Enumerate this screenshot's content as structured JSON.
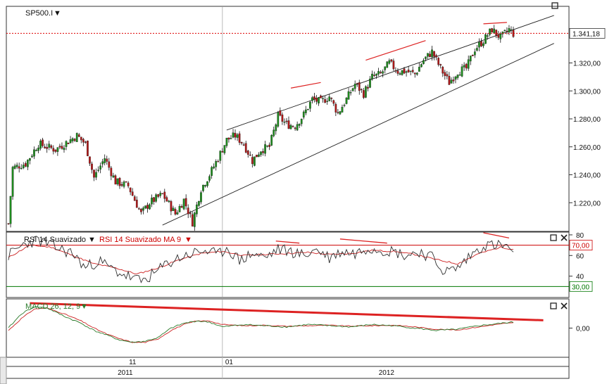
{
  "chart_data": [
    {
      "type": "candlestick",
      "panel": "price",
      "symbol": "SP500.I",
      "ylim": [
        1200,
        1360
      ],
      "y_ticks": [
        1220,
        1240,
        1260,
        1280,
        1300,
        1320
      ],
      "y_tick_labels": [
        "1.220,00",
        "1.240,00",
        "1.260,00",
        "1.280,00",
        "1.300,00",
        "1.320,00"
      ],
      "last_price": 1341.18,
      "last_price_label": "1.341,18",
      "colors": {
        "up": "#1e8c1e",
        "down": "#b01818",
        "price_line": "#dd0000"
      },
      "close_path": [
        [
          0,
          1205
        ],
        [
          2,
          1245
        ],
        [
          8,
          1248
        ],
        [
          14,
          1262
        ],
        [
          22,
          1258
        ],
        [
          28,
          1264
        ],
        [
          32,
          1268
        ],
        [
          36,
          1262
        ],
        [
          40,
          1238
        ],
        [
          45,
          1252
        ],
        [
          50,
          1235
        ],
        [
          56,
          1232
        ],
        [
          62,
          1212
        ],
        [
          66,
          1220
        ],
        [
          72,
          1226
        ],
        [
          78,
          1212
        ],
        [
          82,
          1222
        ],
        [
          86,
          1206
        ],
        [
          90,
          1230
        ],
        [
          94,
          1240
        ],
        [
          98,
          1252
        ],
        [
          102,
          1265
        ],
        [
          106,
          1268
        ],
        [
          110,
          1262
        ],
        [
          114,
          1250
        ],
        [
          118,
          1258
        ],
        [
          122,
          1260
        ],
        [
          126,
          1282
        ],
        [
          130,
          1276
        ],
        [
          134,
          1275
        ],
        [
          138,
          1283
        ],
        [
          142,
          1294
        ],
        [
          146,
          1292
        ],
        [
          150,
          1296
        ],
        [
          154,
          1284
        ],
        [
          158,
          1294
        ],
        [
          162,
          1305
        ],
        [
          166,
          1298
        ],
        [
          170,
          1310
        ],
        [
          174,
          1312
        ],
        [
          178,
          1320
        ],
        [
          182,
          1314
        ],
        [
          186,
          1314
        ],
        [
          190,
          1312
        ],
        [
          194,
          1322
        ],
        [
          198,
          1328
        ],
        [
          202,
          1316
        ],
        [
          206,
          1306
        ],
        [
          210,
          1314
        ],
        [
          214,
          1316
        ],
        [
          218,
          1330
        ],
        [
          222,
          1336
        ],
        [
          226,
          1344
        ],
        [
          230,
          1338
        ],
        [
          234,
          1344
        ],
        [
          236,
          1341
        ]
      ],
      "trendlines": [
        {
          "kind": "upper-wedge",
          "x1": 102,
          "y1": 1272,
          "x2": 255,
          "y2": 1354,
          "color": "#222222"
        },
        {
          "kind": "lower-wedge",
          "x1": 72,
          "y1": 1204,
          "x2": 255,
          "y2": 1334,
          "color": "#222222"
        },
        {
          "kind": "divergence",
          "x1": 132,
          "y1": 1302,
          "x2": 146,
          "y2": 1306,
          "color": "#dd2222"
        },
        {
          "kind": "divergence",
          "x1": 167,
          "y1": 1322,
          "x2": 195,
          "y2": 1336,
          "color": "#dd2222"
        },
        {
          "kind": "divergence",
          "x1": 222,
          "y1": 1348,
          "x2": 233,
          "y2": 1349,
          "color": "#dd2222"
        }
      ]
    },
    {
      "type": "line",
      "panel": "rsi",
      "title": "RSI 14 Suavizado",
      "ma_title": "RSI 14 Suavizado MA 9",
      "ylim": [
        20,
        82
      ],
      "y_ticks": [
        40,
        60,
        80
      ],
      "y_tick_labels": [
        "40",
        "60",
        "80"
      ],
      "levels": [
        {
          "value": 70,
          "label": "70,00",
          "color": "#cc0000"
        },
        {
          "value": 30,
          "label": "30,00",
          "color": "#007700"
        }
      ],
      "series": [
        {
          "name": "RSI 14 Suavizado",
          "color": "#303030",
          "path": [
            [
              0,
              60
            ],
            [
              8,
              72
            ],
            [
              14,
              75
            ],
            [
              22,
              68
            ],
            [
              30,
              62
            ],
            [
              36,
              48
            ],
            [
              42,
              55
            ],
            [
              50,
              45
            ],
            [
              58,
              38
            ],
            [
              62,
              35
            ],
            [
              68,
              42
            ],
            [
              74,
              52
            ],
            [
              80,
              58
            ],
            [
              86,
              62
            ],
            [
              92,
              65
            ],
            [
              98,
              60
            ],
            [
              102,
              68
            ],
            [
              108,
              55
            ],
            [
              114,
              62
            ],
            [
              120,
              58
            ],
            [
              126,
              66
            ],
            [
              132,
              64
            ],
            [
              138,
              60
            ],
            [
              144,
              66
            ],
            [
              150,
              58
            ],
            [
              156,
              64
            ],
            [
              162,
              62
            ],
            [
              168,
              68
            ],
            [
              174,
              66
            ],
            [
              180,
              64
            ],
            [
              186,
              60
            ],
            [
              192,
              64
            ],
            [
              198,
              58
            ],
            [
              204,
              44
            ],
            [
              210,
              48
            ],
            [
              216,
              60
            ],
            [
              222,
              70
            ],
            [
              228,
              70
            ],
            [
              234,
              68
            ],
            [
              236,
              62
            ]
          ]
        },
        {
          "name": "RSI 14 Suavizado MA 9",
          "color": "#cc2222",
          "path": [
            [
              0,
              58
            ],
            [
              10,
              70
            ],
            [
              20,
              68
            ],
            [
              30,
              60
            ],
            [
              40,
              52
            ],
            [
              50,
              48
            ],
            [
              60,
              42
            ],
            [
              70,
              48
            ],
            [
              80,
              56
            ],
            [
              90,
              62
            ],
            [
              100,
              64
            ],
            [
              110,
              60
            ],
            [
              120,
              61
            ],
            [
              130,
              62
            ],
            [
              140,
              63
            ],
            [
              150,
              61
            ],
            [
              160,
              62
            ],
            [
              170,
              65
            ],
            [
              180,
              64
            ],
            [
              190,
              61
            ],
            [
              200,
              56
            ],
            [
              210,
              52
            ],
            [
              220,
              62
            ],
            [
              230,
              68
            ],
            [
              236,
              66
            ]
          ]
        }
      ],
      "divergence_lines": [
        {
          "x1": 125,
          "y1": 74,
          "x2": 136,
          "y2": 72,
          "color": "#dd2222"
        },
        {
          "x1": 155,
          "y1": 76,
          "x2": 177,
          "y2": 72,
          "color": "#dd2222"
        },
        {
          "x1": 222,
          "y1": 82,
          "x2": 234,
          "y2": 77,
          "color": "#dd2222"
        }
      ]
    },
    {
      "type": "line",
      "panel": "macd",
      "title": "MACD 26, 12, 9",
      "ylim": [
        -12,
        12
      ],
      "y_ticks": [
        0
      ],
      "y_tick_labels": [
        "0,00"
      ],
      "series": [
        {
          "name": "MACD",
          "color": "#2a7a2a",
          "path": [
            [
              0,
              0
            ],
            [
              6,
              6
            ],
            [
              12,
              9
            ],
            [
              18,
              8.5
            ],
            [
              26,
              5
            ],
            [
              34,
              2
            ],
            [
              40,
              -1
            ],
            [
              46,
              -3
            ],
            [
              52,
              -5
            ],
            [
              58,
              -6
            ],
            [
              64,
              -5.5
            ],
            [
              70,
              -4
            ],
            [
              76,
              0
            ],
            [
              82,
              2
            ],
            [
              88,
              3
            ],
            [
              94,
              2.5
            ],
            [
              100,
              0.5
            ],
            [
              110,
              1.5
            ],
            [
              120,
              1
            ],
            [
              130,
              0.5
            ],
            [
              140,
              1.5
            ],
            [
              150,
              1
            ],
            [
              160,
              0.5
            ],
            [
              170,
              1.5
            ],
            [
              180,
              1
            ],
            [
              190,
              0
            ],
            [
              200,
              -1
            ],
            [
              210,
              -0.5
            ],
            [
              220,
              1
            ],
            [
              230,
              2
            ],
            [
              236,
              2.5
            ]
          ]
        },
        {
          "name": "Signal",
          "color": "#cc2222",
          "path": [
            [
              0,
              -1
            ],
            [
              6,
              4
            ],
            [
              12,
              8
            ],
            [
              18,
              8.5
            ],
            [
              26,
              6
            ],
            [
              34,
              3
            ],
            [
              40,
              0
            ],
            [
              46,
              -2.5
            ],
            [
              52,
              -4.5
            ],
            [
              58,
              -6
            ],
            [
              64,
              -6
            ],
            [
              70,
              -4.5
            ],
            [
              76,
              -1
            ],
            [
              82,
              1.5
            ],
            [
              88,
              3
            ],
            [
              94,
              3
            ],
            [
              100,
              1.5
            ],
            [
              110,
              1
            ],
            [
              120,
              1.2
            ],
            [
              130,
              0.8
            ],
            [
              140,
              1
            ],
            [
              150,
              1.2
            ],
            [
              160,
              0.8
            ],
            [
              170,
              1
            ],
            [
              180,
              1.2
            ],
            [
              190,
              0.5
            ],
            [
              200,
              -0.5
            ],
            [
              210,
              -0.8
            ],
            [
              220,
              0.5
            ],
            [
              230,
              1.8
            ],
            [
              236,
              2.2
            ]
          ]
        }
      ],
      "divergence_lines": [
        {
          "x1": 10,
          "y1": 10.5,
          "x2": 250,
          "y2": 3.3,
          "color": "#dd2222"
        }
      ]
    }
  ],
  "time_axis": {
    "minor_labels": [
      {
        "x": 55,
        "text": "11"
      },
      {
        "x": 100,
        "text": "01"
      }
    ],
    "major_labels": [
      {
        "x": 55,
        "text": "2011"
      },
      {
        "x": 177,
        "text": "2012"
      }
    ],
    "separator_x": 100,
    "bar_count": 237,
    "x_range": [
      0,
      262
    ]
  },
  "ui": {
    "symbol_menu_label": "SP500.I",
    "rsi_menu_label": "RSI 14 Suavizado",
    "rsi_ma_label": "RSI 14 Suavizado MA 9",
    "macd_menu_label": "MACD 26, 12, 9"
  }
}
